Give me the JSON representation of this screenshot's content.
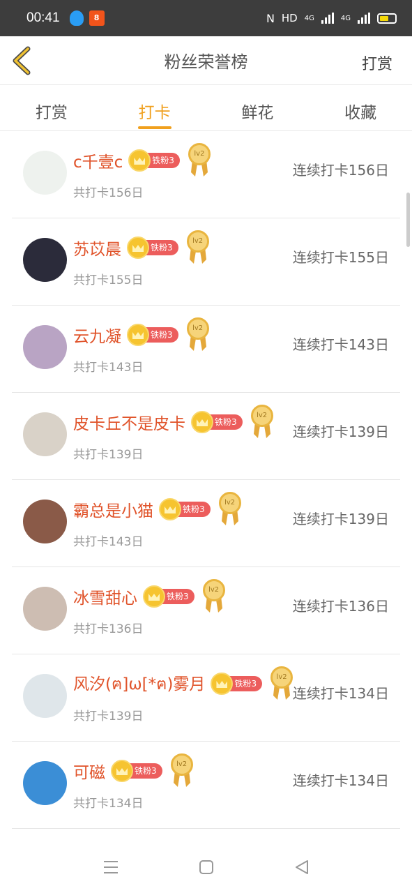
{
  "status_bar": {
    "time": "00:41",
    "hd_label": "HD",
    "net1": "4G",
    "net2": "4G",
    "battery_color": "#f5d90a"
  },
  "header": {
    "back_icon": "chevron-left-icon",
    "title": "粉丝荣誉榜",
    "action_label": "打赏"
  },
  "tabs": [
    {
      "label": "打赏",
      "active": false
    },
    {
      "label": "打卡",
      "active": true
    },
    {
      "label": "鲜花",
      "active": false
    },
    {
      "label": "收藏",
      "active": false
    }
  ],
  "accent_color": "#f0a01e",
  "name_color": "#e0532a",
  "entries": [
    {
      "name": "c千壹c",
      "badge": "铁粉3",
      "medal": "lv2",
      "total": "共打卡156日",
      "streak": "连续打卡156日",
      "avatar_color": "#eef2ee"
    },
    {
      "name": "苏苡晨",
      "badge": "铁粉3",
      "medal": "lv2",
      "total": "共打卡155日",
      "streak": "连续打卡155日",
      "avatar_color": "#2b2b3a"
    },
    {
      "name": "云九凝",
      "badge": "铁粉3",
      "medal": "lv2",
      "total": "共打卡143日",
      "streak": "连续打卡143日",
      "avatar_color": "#b9a4c4"
    },
    {
      "name": "皮卡丘不是皮卡",
      "badge": "铁粉3",
      "medal": "lv2",
      "total": "共打卡139日",
      "streak": "连续打卡139日",
      "avatar_color": "#d9d2c8"
    },
    {
      "name": "霸总是小猫",
      "badge": "铁粉3",
      "medal": "lv2",
      "total": "共打卡143日",
      "streak": "连续打卡139日",
      "avatar_color": "#8a5a48"
    },
    {
      "name": "冰雪甜心",
      "badge": "铁粉3",
      "medal": "lv2",
      "total": "共打卡136日",
      "streak": "连续打卡136日",
      "avatar_color": "#cdbdb2"
    },
    {
      "name": "风汐(ฅ]ω[*ฅ)雾月",
      "badge": "铁粉3",
      "medal": "lv2",
      "total": "共打卡139日",
      "streak": "连续打卡134日",
      "avatar_color": "#dfe6ea"
    },
    {
      "name": "可磁",
      "badge": "铁粉3",
      "medal": "lv2",
      "total": "共打卡134日",
      "streak": "连续打卡134日",
      "avatar_color": "#3b8ed6"
    }
  ],
  "nav_bar": {
    "menu_icon": "menu-icon",
    "home_icon": "home-square-icon",
    "back_icon": "back-triangle-icon"
  }
}
